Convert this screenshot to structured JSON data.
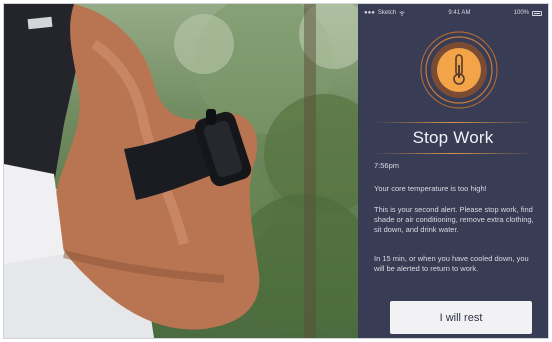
{
  "status_bar": {
    "carrier": "Sketch",
    "time": "9:41 AM",
    "battery": "100%"
  },
  "alert": {
    "icon": "thermometer-icon",
    "title": "Stop Work",
    "time": "7:56pm",
    "message_1": "Your core temperature is too high!",
    "message_2": "This is your second alert. Please stop work, find shade or air conditioning, remove extra clothing, sit down, and drink water.",
    "message_3": "In 15 min, or when you have cooled down, you will be alerted to return to work.",
    "button_label": "I will rest"
  },
  "colors": {
    "panel_background": "#383c55",
    "accent_orange": "#e8913a",
    "button_background": "#f2f1f4"
  }
}
